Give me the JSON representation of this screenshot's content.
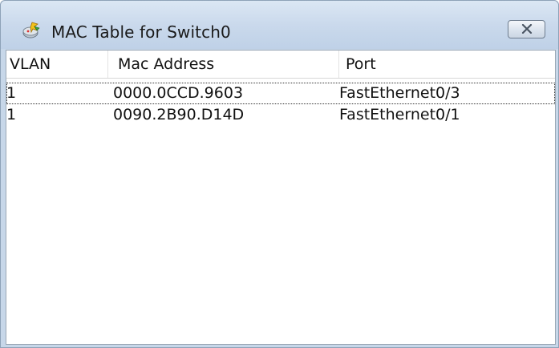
{
  "window": {
    "title": "MAC Table for Switch0"
  },
  "table": {
    "columns": [
      "VLAN",
      "Mac Address",
      "Port"
    ],
    "rows": [
      {
        "vlan": "1",
        "mac": "0000.0CCD.9603",
        "port": "FastEthernet0/3",
        "focused": true
      },
      {
        "vlan": "1",
        "mac": "0090.2B90.D14D",
        "port": "FastEthernet0/1",
        "focused": false
      }
    ]
  },
  "icons": {
    "app": "packet-tracer-app-icon",
    "close": "close-icon"
  },
  "colors": {
    "titlebar": "#c7d7e9",
    "frame_border": "#8ea2b8",
    "list_background": "#ffffff"
  }
}
